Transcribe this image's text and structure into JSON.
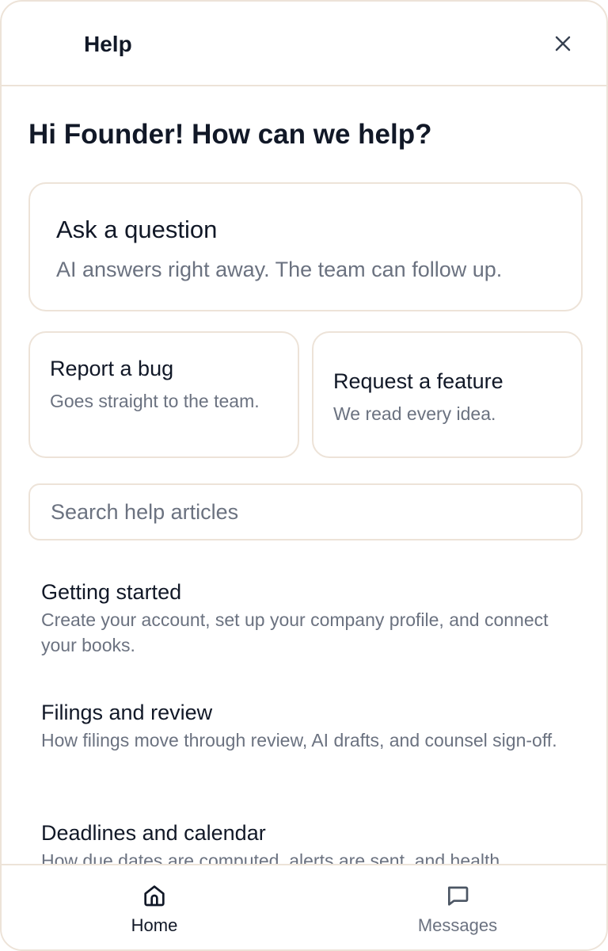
{
  "header": {
    "title": "Help",
    "close_icon": "close-icon"
  },
  "greeting": "Hi Founder! How can we help?",
  "cards": {
    "ask": {
      "title": "Ask a question",
      "description": "AI answers right away. The team can follow up."
    },
    "bug": {
      "title": "Report a bug",
      "description": "Goes straight to the team."
    },
    "feature": {
      "title": "Request a feature",
      "description": "We read every idea."
    }
  },
  "search": {
    "placeholder": "Search help articles",
    "value": ""
  },
  "articles": [
    {
      "title": "Getting started",
      "description": "Create your account, set up your company profile, and connect your books."
    },
    {
      "title": "Filings and review",
      "description": "How filings move through review, AI drafts, and counsel sign-off."
    },
    {
      "title": "Deadlines and calendar",
      "description": "How due dates are computed, alerts are sent, and health"
    }
  ],
  "nav": {
    "home": {
      "label": "Home",
      "icon": "home-icon",
      "active": true
    },
    "messages": {
      "label": "Messages",
      "icon": "message-icon",
      "active": false
    }
  },
  "colors": {
    "border": "#ede3d8",
    "text_primary": "#111827",
    "text_secondary": "#6b7280",
    "background": "#ffffff"
  }
}
